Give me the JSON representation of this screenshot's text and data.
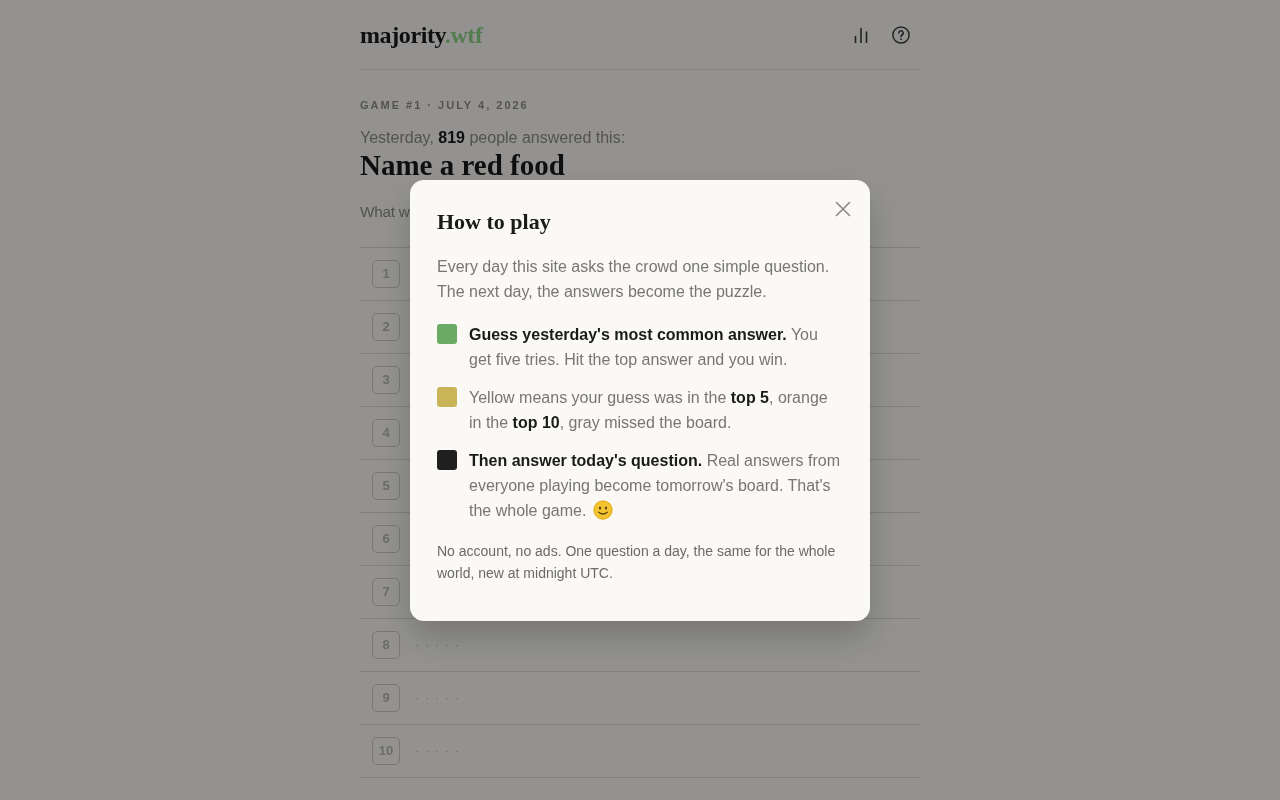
{
  "header": {
    "logo": {
      "name": "majority",
      "domain": ".wtf"
    }
  },
  "game_label": "GAME #1 · JULY 4, 2026",
  "lead": "Yesterday, **819** people answered this:",
  "question": "Name a red food",
  "subtitle": "What w",
  "answer_rows": [
    {
      "number": "1"
    },
    {
      "number": "2"
    },
    {
      "number": "3"
    },
    {
      "number": "4"
    },
    {
      "number": "5"
    },
    {
      "number": "6"
    },
    {
      "number": "7"
    },
    {
      "number": "8",
      "text": "· · · · ·"
    },
    {
      "number": "9",
      "text": "· · · · ·"
    },
    {
      "number": "10",
      "text": "· · · · ·"
    }
  ],
  "dialog": {
    "title": "How to play",
    "intro": "Every day this site asks the crowd one simple question. The next day, the answers become the puzzle.",
    "rules": [
      {
        "color": "#6aaa64",
        "text": "**Guess yesterday's most common answer.** You get five tries. Hit the top answer and you win."
      },
      {
        "color": "#c9b458",
        "text": "Yellow means your guess was in the **top 5**, orange in the **top 10**, gray missed the board."
      },
      {
        "color": "#1f1f1f",
        "text": "**Then answer today's question.** Real answers from everyone playing become tomorrow's board. That's the whole game.",
        "end_icon": true
      }
    ],
    "footer": "No account, no ads. One question a day, the same for the whole world, new at midnight UTC."
  }
}
